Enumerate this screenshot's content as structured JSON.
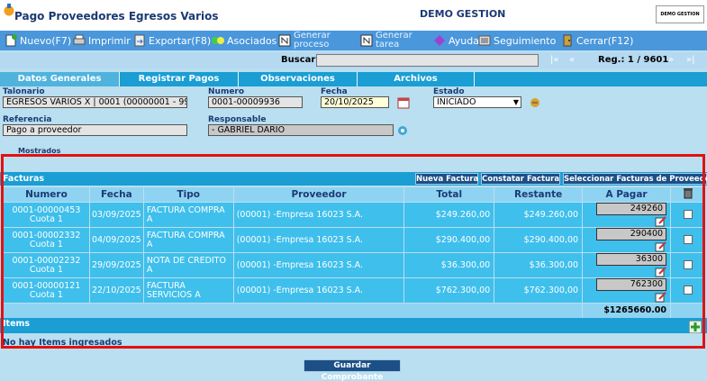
{
  "window": {
    "title": "Pago Proveedores Egresos Varios",
    "company": "DEMO GESTION",
    "logo_text": "DEMO GESTION"
  },
  "toolbar": {
    "nuevo": "Nuevo(F7)",
    "imprimir": "Imprimir",
    "exportar": "Exportar(F8)",
    "asociados": "Asociados",
    "generar_proceso_1": "Generar",
    "generar_proceso_2": "proceso",
    "generar_tarea_1": "Generar",
    "generar_tarea_2": "tarea",
    "ayuda": "Ayuda",
    "seguimiento": "Seguimiento",
    "cerrar": "Cerrar(F12)"
  },
  "search": {
    "label": "Buscar",
    "value": "",
    "first": "|«",
    "prev": "«",
    "record": "Reg.: 1 / 9601",
    "next": "»",
    "last": "»|"
  },
  "tabs": [
    "Datos Generales",
    "Registrar Pagos",
    "Observaciones",
    "Archivos"
  ],
  "form": {
    "talonario_label": "Talonario",
    "talonario_value": "EGRESOS VARIOS X | 0001 (00000001 - 99",
    "numero_label": "Numero",
    "numero_value": "0001-00009936",
    "fecha_label": "Fecha",
    "fecha_value": "20/10/2025",
    "estado_label": "Estado",
    "estado_value": "INICIADO",
    "referencia_label": "Referencia",
    "referencia_value": "Pago a proveedor",
    "responsable_label": "Responsable",
    "responsable_value": "- GABRIEL DARIO",
    "mostrados_label": "Mostrados"
  },
  "facturas": {
    "title": "Facturas",
    "btn_nueva": "Nueva Factura",
    "btn_constatar": "Constatar Factura",
    "btn_seleccionar": "Seleccionar Facturas de Proveedor",
    "columns": [
      "Numero",
      "Fecha",
      "Tipo",
      "Proveedor",
      "Total",
      "Restante",
      "A Pagar"
    ],
    "rows": [
      {
        "numero": "0001-00000453",
        "cuota": "Cuota 1",
        "fecha": "03/09/2025",
        "tipo1": "FACTURA COMPRA",
        "tipo2": "A",
        "proveedor": "(00001) -Empresa 16023 S.A.",
        "total": "$249.260,00",
        "restante": "$249.260,00",
        "apagar": "249260"
      },
      {
        "numero": "0001-00002332",
        "cuota": "Cuota 1",
        "fecha": "04/09/2025",
        "tipo1": "FACTURA COMPRA",
        "tipo2": "A",
        "proveedor": "(00001) -Empresa 16023 S.A.",
        "total": "$290.400,00",
        "restante": "$290.400,00",
        "apagar": "290400"
      },
      {
        "numero": "0001-00002232",
        "cuota": "Cuota 1",
        "fecha": "29/09/2025",
        "tipo1": "NOTA DE CREDITO",
        "tipo2": "A",
        "proveedor": "(00001) -Empresa 16023 S.A.",
        "total": "$36.300,00",
        "restante": "$36.300,00",
        "apagar": "36300"
      },
      {
        "numero": "0001-00000121",
        "cuota": "Cuota 1",
        "fecha": "22/10/2025",
        "tipo1": "FACTURA",
        "tipo2": "SERVICIOS A",
        "proveedor": "(00001) -Empresa 16023 S.A.",
        "total": "$762.300,00",
        "restante": "$762.300,00",
        "apagar": "762300"
      }
    ],
    "total": "$1265660.00"
  },
  "items": {
    "title": "Items",
    "empty": "No hay Items ingresados"
  },
  "footer": {
    "save": "Guardar Comprobante"
  }
}
